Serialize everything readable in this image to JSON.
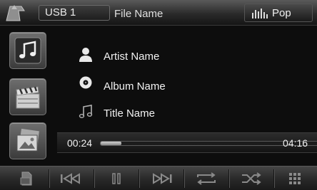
{
  "header": {
    "source_label": "USB 1",
    "file_label": "File Name",
    "eq_label": "Pop"
  },
  "sidebar": {
    "items": [
      {
        "name": "music",
        "icon": "music-note-icon"
      },
      {
        "name": "video",
        "icon": "clapperboard-icon"
      },
      {
        "name": "photo",
        "icon": "photo-icon"
      }
    ]
  },
  "track_info": {
    "artist": "Artist Name",
    "album": "Album Name",
    "title": "Title Name"
  },
  "playback": {
    "elapsed": "00:24",
    "total": "04:16",
    "progress_fraction": 0.09
  },
  "controls": [
    {
      "name": "menu",
      "icon": "menu-icon"
    },
    {
      "name": "previous",
      "icon": "skip-previous-icon"
    },
    {
      "name": "pause",
      "icon": "pause-icon"
    },
    {
      "name": "next",
      "icon": "skip-next-icon"
    },
    {
      "name": "repeat",
      "icon": "repeat-icon"
    },
    {
      "name": "shuffle",
      "icon": "shuffle-icon"
    },
    {
      "name": "grid",
      "icon": "grid-icon"
    }
  ],
  "colors": {
    "background": "#0d0d0d",
    "text": "#f2f2f2",
    "bar": "#2b2b2b"
  }
}
